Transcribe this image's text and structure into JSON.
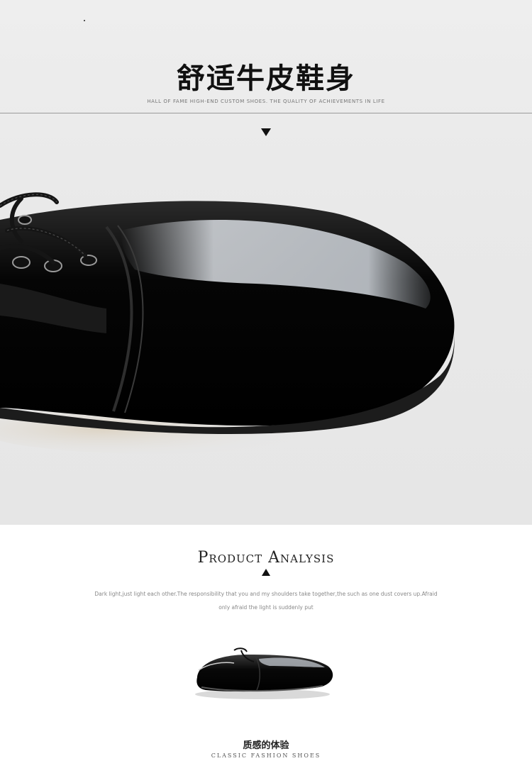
{
  "hero": {
    "title": "舒适牛皮鞋身",
    "subtitle": "HALL OF FAME HIGH-END CUSTOM SHOES. THE QUALITY OF ACHIEVEMENTS IN LIFE"
  },
  "analysis": {
    "title": "Product Analysis",
    "description": "Dark light,just light each other.The responsibility that you and my shoulders take together,the such as one dust covers up.Afraid only afraid the light is suddenly put"
  },
  "caption": {
    "title": "质感的体验",
    "subtitle": "CLASSIC FASHION SHOES"
  },
  "colors": {
    "panel_bg": "#e9e9e9",
    "leather": "#0a0a0a",
    "text_dark": "#111111"
  }
}
